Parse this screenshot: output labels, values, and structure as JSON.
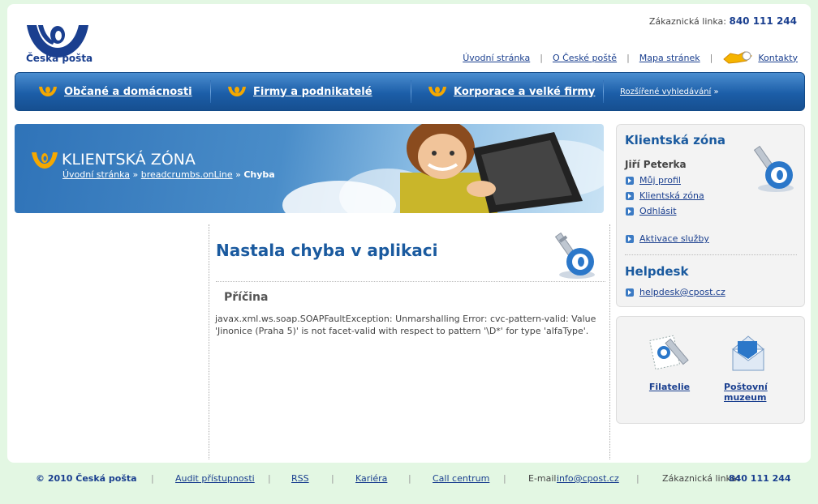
{
  "header": {
    "logo_text": "Česká pošta",
    "hotline_label": "Zákaznická linka:",
    "hotline_number": "840 111 244",
    "links": [
      "Úvodní stránka",
      "O České poště",
      "Mapa stránek"
    ],
    "contacts": "Kontakty"
  },
  "nav": {
    "items": [
      "Občané a domácnosti",
      "Firmy a podnikatelé",
      "Korporace a velké firmy"
    ],
    "search": "Rozšířené vyhledávání",
    "search_arrow": "»"
  },
  "banner": {
    "title": "KLIENTSKÁ ZÓNA",
    "crumbs": [
      "Úvodní stránka",
      "breadcrumbs.onLine"
    ],
    "crumb_sep": "»",
    "current": "Chyba"
  },
  "main": {
    "error_title": "Nastala chyba v aplikaci",
    "cause_label": "Příčina",
    "cause_text": "javax.xml.ws.soap.SOAPFaultException: Unmarshalling Error: cvc-pattern-valid: Value 'Jinonice (Praha 5)' is not facet-valid with respect to pattern '\\D*' for type 'alfaType'."
  },
  "sidebar": {
    "zone_title": "Klientská zóna",
    "user_name": "Jiří Peterka",
    "links": [
      "Můj profil",
      "Klientská zóna",
      "Odhlásit"
    ],
    "activation": "Aktivace služby",
    "helpdesk_title": "Helpdesk",
    "helpdesk_email": "helpdesk@cpost.cz",
    "tiles": [
      "Filatelie",
      "Poštovní muzeum"
    ]
  },
  "footer": {
    "copyright": "© 2010 Česká pošta",
    "links": [
      "Audit přístupnosti",
      "RSS",
      "Kariéra",
      "Call centrum"
    ],
    "email_label": "E-mail:",
    "email": "info@cpost.cz",
    "hotline_label": "Zákaznická linka:",
    "hotline_number": "840 111 244"
  },
  "colors": {
    "brand": "#1a3f8f",
    "nav": "#1c5ea8",
    "accent": "#f5a800",
    "background": "#e3f7e3"
  }
}
